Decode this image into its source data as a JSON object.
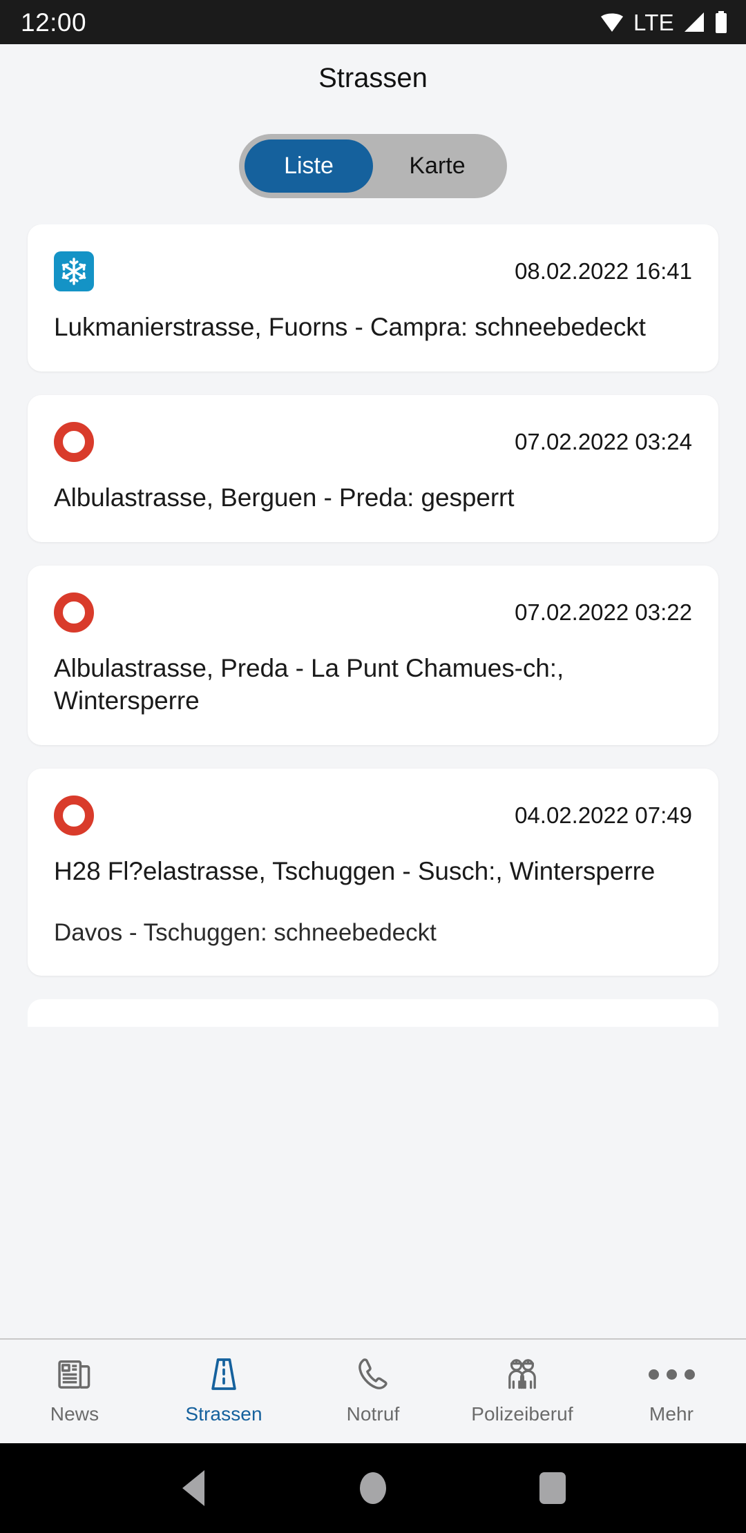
{
  "status_bar": {
    "time": "12:00",
    "network_label": "LTE",
    "icons": [
      "wifi-icon",
      "signal-icon",
      "battery-icon"
    ]
  },
  "header": {
    "title": "Strassen"
  },
  "segmented_control": {
    "options": [
      {
        "label": "Liste",
        "active": true
      },
      {
        "label": "Karte",
        "active": false
      }
    ],
    "active_color": "#15619d",
    "track_color": "#b5b5b5"
  },
  "list": {
    "cards": [
      {
        "icon": "snowflake-icon",
        "icon_kind": "snow",
        "icon_color": "#1493c6",
        "timestamp": "08.02.2022 16:41",
        "title": "Lukmanierstrasse,  Fuorns - Campra: schneebedeckt",
        "subtitle": ""
      },
      {
        "icon": "road-closed-icon",
        "icon_kind": "closed",
        "icon_color": "#d93b2b",
        "timestamp": "07.02.2022 03:24",
        "title": "Albulastrasse,  Berguen - Preda: gesperrt",
        "subtitle": ""
      },
      {
        "icon": "road-closed-icon",
        "icon_kind": "closed",
        "icon_color": "#d93b2b",
        "timestamp": "07.02.2022 03:22",
        "title": "Albulastrasse,  Preda - La Punt Chamues-ch:, Wintersperre",
        "subtitle": ""
      },
      {
        "icon": "road-closed-icon",
        "icon_kind": "closed",
        "icon_color": "#d93b2b",
        "timestamp": "04.02.2022 07:49",
        "title": "H28 Fl?elastrasse,  Tschuggen - Susch:, Wintersperre",
        "subtitle": "Davos - Tschuggen: schneebedeckt"
      }
    ]
  },
  "tab_bar": {
    "tabs": [
      {
        "label": "News",
        "icon": "newspaper-icon",
        "active": false
      },
      {
        "label": "Strassen",
        "icon": "road-icon",
        "active": true
      },
      {
        "label": "Notruf",
        "icon": "phone-icon",
        "active": false
      },
      {
        "label": "Polizeiberuf",
        "icon": "people-icon",
        "active": false
      },
      {
        "label": "Mehr",
        "icon": "more-dots-icon",
        "active": false
      }
    ],
    "active_color": "#15619d",
    "inactive_color": "#6b6b6b"
  },
  "system_nav": {
    "buttons": [
      "back-button",
      "home-button",
      "recent-apps-button"
    ]
  }
}
